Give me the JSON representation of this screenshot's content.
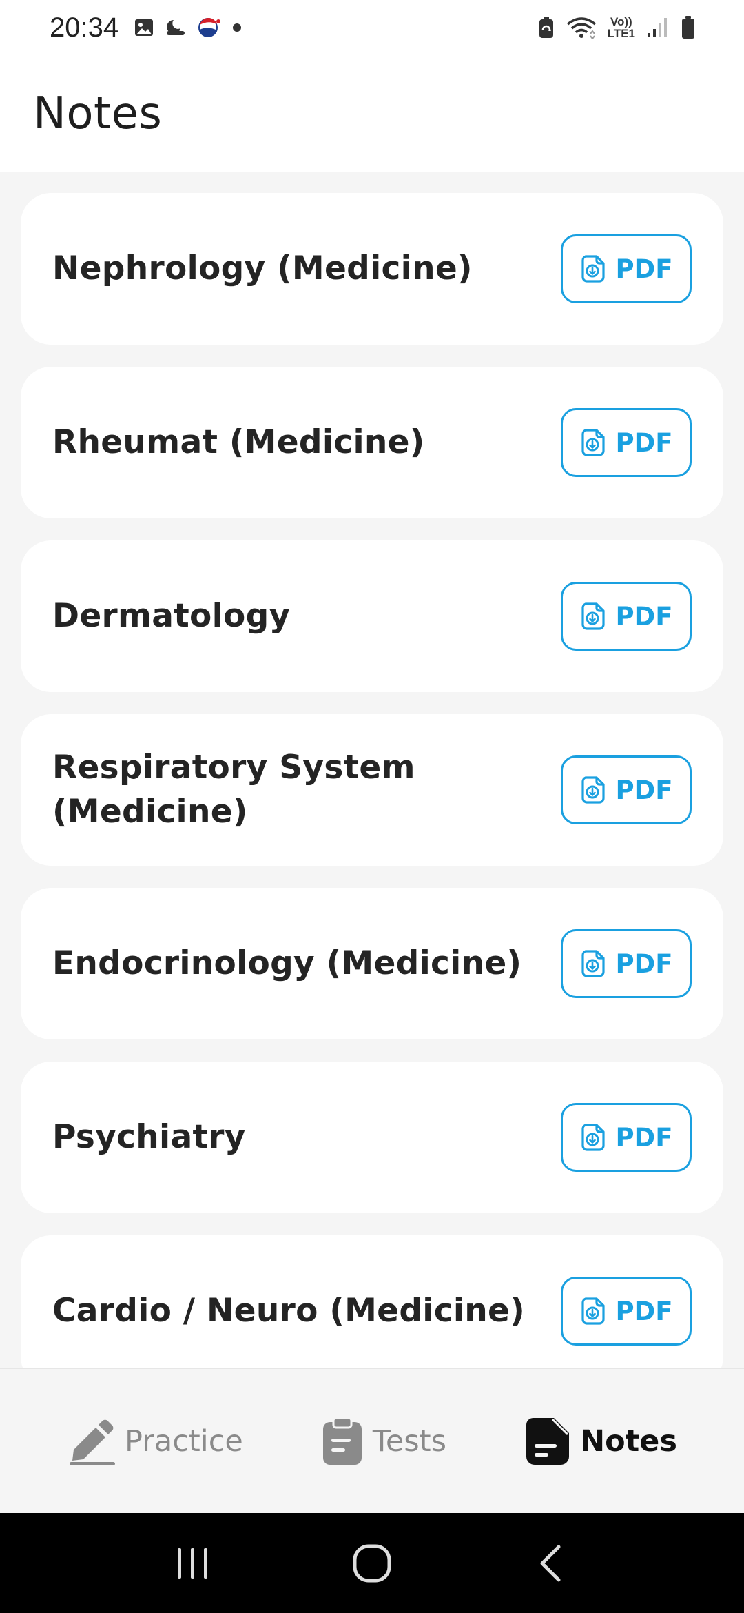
{
  "status_bar": {
    "time": "20:34",
    "lte_top": "Vo))",
    "lte_bottom": "LTE1",
    "icons_left": [
      "image-icon",
      "weather-icon",
      "pepsi-icon",
      "dot-icon"
    ],
    "icons_right": [
      "battery-saver-icon",
      "wifi-icon",
      "lte-icon",
      "signal-icon",
      "battery-icon"
    ]
  },
  "header": {
    "title": "Notes"
  },
  "notes": [
    {
      "title": "Nephrology (Medicine)",
      "button_label": "PDF"
    },
    {
      "title": "Rheumat (Medicine)",
      "button_label": "PDF"
    },
    {
      "title": "Dermatology",
      "button_label": "PDF"
    },
    {
      "title": "Respiratory System (Medicine)",
      "button_label": "PDF"
    },
    {
      "title": "Endocrinology (Medicine)",
      "button_label": "PDF"
    },
    {
      "title": "Psychiatry",
      "button_label": "PDF"
    },
    {
      "title": "Cardio / Neuro (Medicine)",
      "button_label": "PDF"
    }
  ],
  "bottom_nav": {
    "items": [
      {
        "label": "Practice",
        "icon": "pencil-icon",
        "active": false
      },
      {
        "label": "Tests",
        "icon": "clipboard-icon",
        "active": false
      },
      {
        "label": "Notes",
        "icon": "notes-icon",
        "active": true
      }
    ]
  },
  "colors": {
    "accent": "#1aa0e0",
    "background": "#f5f5f5",
    "card": "#ffffff",
    "text": "#242424",
    "nav_inactive": "#8a8a8a"
  }
}
